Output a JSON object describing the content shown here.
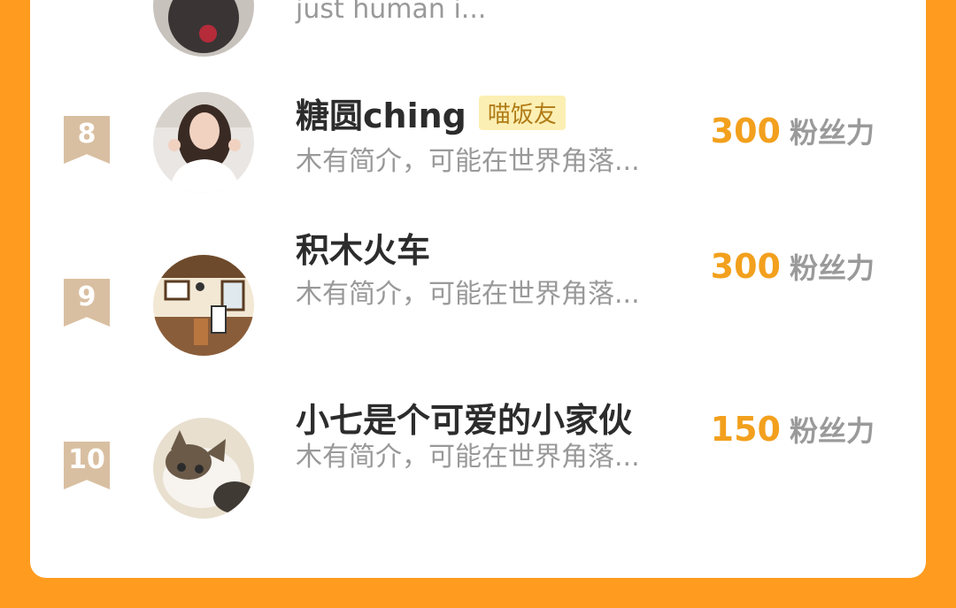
{
  "ranking": {
    "partial_row": {
      "bio": "just human i..."
    },
    "rows": [
      {
        "rank": "8",
        "name": "糖圆ching",
        "tag": "喵饭友",
        "bio": "木有简介，可能在世界角落...",
        "score": "300",
        "score_unit": "粉丝力",
        "avatar_icon": "girl-photo-avatar"
      },
      {
        "rank": "9",
        "name": "积木火车",
        "tag": "",
        "bio": "木有简介，可能在世界角落...",
        "score": "300",
        "score_unit": "粉丝力",
        "avatar_icon": "cartoon-room-avatar"
      },
      {
        "rank": "10",
        "name": "小七是个可爱的小家伙",
        "tag": "",
        "bio": "木有简介，可能在世界角落...",
        "score": "150",
        "score_unit": "粉丝力",
        "avatar_icon": "kitten-photo-avatar"
      }
    ]
  },
  "colors": {
    "background": "#ff9c1f",
    "score_orange": "#f2a01d",
    "rank_badge": "#d9bfa1",
    "tag_background": "#fcefb3"
  }
}
